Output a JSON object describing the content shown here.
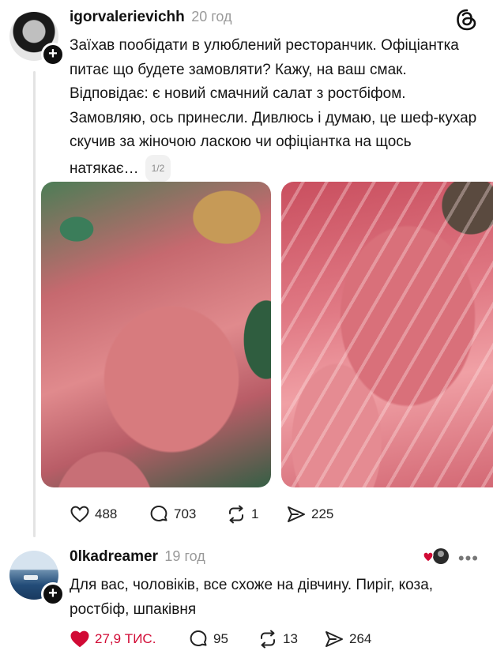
{
  "post": {
    "username": "igorvalerievichh",
    "time": "20 год",
    "text": "Заїхав пообідати в улюблений ресторанчик. Офіціантка питає що будете замовляти? Кажу, на ваш смак. Відповідає: є новий смачний салат з ростбіфом. Замовляю, ось принесли. Дивлюсь і думаю, це шеф-кухар скучив за жіночою ласкою чи офіціантка на щось натякає…",
    "page_indicator": "1/2",
    "actions": {
      "likes": "488",
      "comments": "703",
      "reposts": "1",
      "shares": "225"
    }
  },
  "comment": {
    "username": "0lkadreamer",
    "time": "19 год",
    "text": "Для вас, чоловіків, все схоже на дівчину. Пиріг, коза, ростбіф, шпаківня",
    "actions": {
      "likes": "27,9 ТИС.",
      "comments": "95",
      "reposts": "13",
      "shares": "264"
    }
  },
  "icons": {
    "app": "threads-logo-icon",
    "heart": "heart-icon",
    "comment": "comment-icon",
    "repost": "repost-icon",
    "share": "share-icon",
    "more": "more-icon",
    "follow": "plus-icon"
  },
  "colors": {
    "liked": "#d10a35",
    "muted": "#9a9a9a",
    "text": "#151515"
  }
}
